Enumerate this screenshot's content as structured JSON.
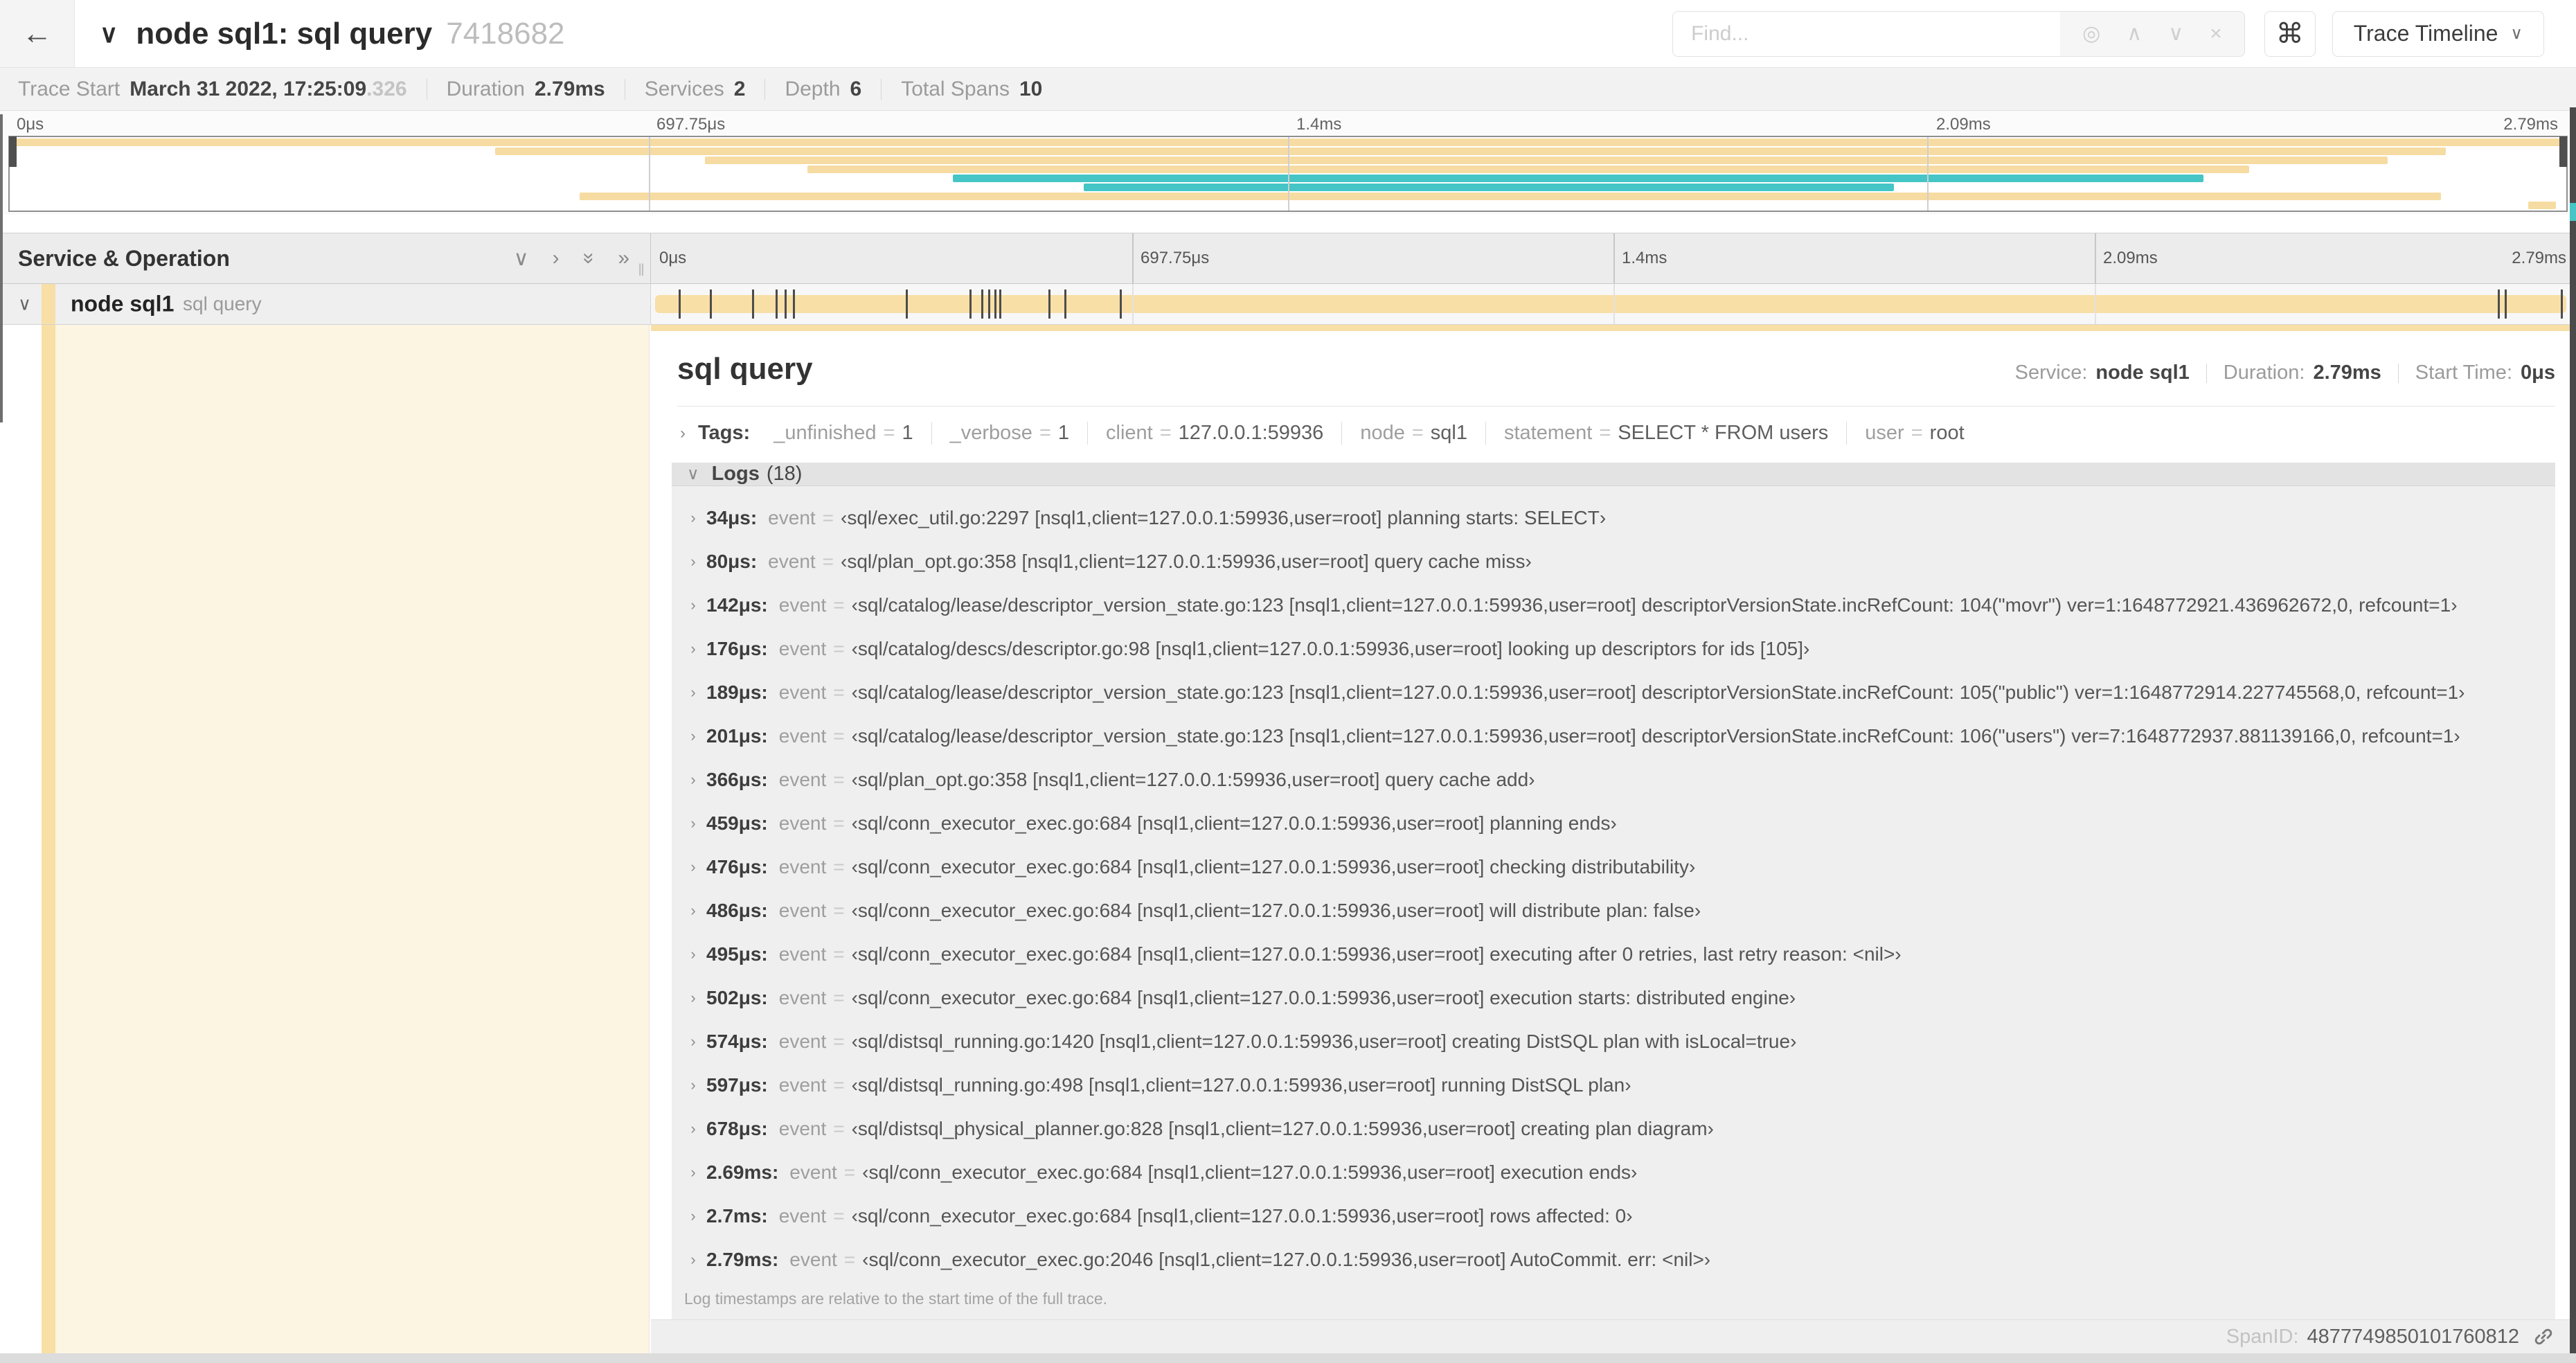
{
  "symbols": {
    "eq": "=",
    "chev_right": "›",
    "chev_down": "∨",
    "resizer": "‖"
  },
  "header": {
    "back": "←",
    "collapse": "∨",
    "title": "node sql1: sql query",
    "trace_id": "7418682",
    "find": {
      "placeholder": "Find...",
      "locate": "◎",
      "prev": "∧",
      "next": "∨",
      "clear": "×"
    },
    "shortcut": "⌘",
    "view_button": "Trace Timeline",
    "view_chevron": "∨"
  },
  "summary": {
    "items": [
      {
        "label": "Trace Start",
        "value": "March 31 2022, 17:25:09",
        "suffix": ".326"
      },
      {
        "label": "Duration",
        "value": "2.79ms",
        "suffix": ""
      },
      {
        "label": "Services",
        "value": "2",
        "suffix": ""
      },
      {
        "label": "Depth",
        "value": "6",
        "suffix": ""
      },
      {
        "label": "Total Spans",
        "value": "10",
        "suffix": ""
      }
    ]
  },
  "axis": [
    {
      "label": "0μs",
      "pct": 0
    },
    {
      "label": "697.75μs",
      "pct": 25
    },
    {
      "label": "1.4ms",
      "pct": 50
    },
    {
      "label": "2.09ms",
      "pct": 75
    },
    {
      "label": "2.79ms",
      "pct": 100
    }
  ],
  "minimap": {
    "colors": {
      "tan": "#f6dca2",
      "teal": "#45c5c5"
    },
    "spans": [
      {
        "row": 0,
        "start": 0,
        "end": 100,
        "color": "tan"
      },
      {
        "row": 1,
        "start": 19,
        "end": 95.3,
        "color": "tan"
      },
      {
        "row": 2,
        "start": 27.2,
        "end": 93,
        "color": "tan"
      },
      {
        "row": 3,
        "start": 31.2,
        "end": 87.6,
        "color": "tan"
      },
      {
        "row": 4,
        "start": 36.9,
        "end": 85.8,
        "color": "teal"
      },
      {
        "row": 5,
        "start": 42,
        "end": 73.7,
        "color": "teal"
      },
      {
        "row": 6,
        "start": 22.3,
        "end": 95.1,
        "color": "tan"
      },
      {
        "row": 7,
        "start": 98.5,
        "end": 99.6,
        "color": "tan"
      }
    ]
  },
  "timeline_head": {
    "title": "Service & Operation",
    "icons": [
      "∨",
      "›",
      "»",
      "»"
    ]
  },
  "span_row": {
    "collapse": "∨",
    "service": "node sql1",
    "operation": "sql query",
    "tick_pcts": [
      1.22,
      2.87,
      5.09,
      6.31,
      6.77,
      7.2,
      13.12,
      16.45,
      17.06,
      17.42,
      17.74,
      17.99,
      20.57,
      21.4,
      24.3,
      96.42,
      96.77,
      99.7
    ]
  },
  "detail": {
    "title": "sql query",
    "meta": [
      {
        "label": "Service:",
        "value": "node sql1"
      },
      {
        "label": "Duration:",
        "value": "2.79ms"
      },
      {
        "label": "Start Time:",
        "value": "0μs"
      }
    ],
    "tags": {
      "label": "Tags:",
      "items": [
        {
          "key": "_unfinished",
          "value": "1"
        },
        {
          "key": "_verbose",
          "value": "1"
        },
        {
          "key": "client",
          "value": "127.0.0.1:59936"
        },
        {
          "key": "node",
          "value": "sql1"
        },
        {
          "key": "statement",
          "value": "SELECT * FROM users"
        },
        {
          "key": "user",
          "value": "root"
        }
      ]
    },
    "logs": {
      "label": "Logs",
      "count": "(18)",
      "key_label": "event",
      "rows": [
        {
          "t": "34μs:",
          "value": "‹sql/exec_util.go:2297 [nsql1,client=127.0.0.1:59936,user=root] planning starts: SELECT›"
        },
        {
          "t": "80μs:",
          "value": "‹sql/plan_opt.go:358 [nsql1,client=127.0.0.1:59936,user=root] query cache miss›"
        },
        {
          "t": "142μs:",
          "value": "‹sql/catalog/lease/descriptor_version_state.go:123 [nsql1,client=127.0.0.1:59936,user=root] descriptorVersionState.incRefCount: 104(\"movr\") ver=1:1648772921.436962672,0, refcount=1›"
        },
        {
          "t": "176μs:",
          "value": "‹sql/catalog/descs/descriptor.go:98 [nsql1,client=127.0.0.1:59936,user=root] looking up descriptors for ids [105]›"
        },
        {
          "t": "189μs:",
          "value": "‹sql/catalog/lease/descriptor_version_state.go:123 [nsql1,client=127.0.0.1:59936,user=root] descriptorVersionState.incRefCount: 105(\"public\") ver=1:1648772914.227745568,0, refcount=1›"
        },
        {
          "t": "201μs:",
          "value": "‹sql/catalog/lease/descriptor_version_state.go:123 [nsql1,client=127.0.0.1:59936,user=root] descriptorVersionState.incRefCount: 106(\"users\") ver=7:1648772937.881139166,0, refcount=1›"
        },
        {
          "t": "366μs:",
          "value": "‹sql/plan_opt.go:358 [nsql1,client=127.0.0.1:59936,user=root] query cache add›"
        },
        {
          "t": "459μs:",
          "value": "‹sql/conn_executor_exec.go:684 [nsql1,client=127.0.0.1:59936,user=root] planning ends›"
        },
        {
          "t": "476μs:",
          "value": "‹sql/conn_executor_exec.go:684 [nsql1,client=127.0.0.1:59936,user=root] checking distributability›"
        },
        {
          "t": "486μs:",
          "value": "‹sql/conn_executor_exec.go:684 [nsql1,client=127.0.0.1:59936,user=root] will distribute plan: false›"
        },
        {
          "t": "495μs:",
          "value": "‹sql/conn_executor_exec.go:684 [nsql1,client=127.0.0.1:59936,user=root] executing after 0 retries, last retry reason: <nil>›"
        },
        {
          "t": "502μs:",
          "value": "‹sql/conn_executor_exec.go:684 [nsql1,client=127.0.0.1:59936,user=root] execution starts: distributed engine›"
        },
        {
          "t": "574μs:",
          "value": "‹sql/distsql_running.go:1420 [nsql1,client=127.0.0.1:59936,user=root] creating DistSQL plan with isLocal=true›"
        },
        {
          "t": "597μs:",
          "value": "‹sql/distsql_running.go:498 [nsql1,client=127.0.0.1:59936,user=root] running DistSQL plan›"
        },
        {
          "t": "678μs:",
          "value": "‹sql/distsql_physical_planner.go:828 [nsql1,client=127.0.0.1:59936,user=root] creating plan diagram›"
        },
        {
          "t": "2.69ms:",
          "value": "‹sql/conn_executor_exec.go:684 [nsql1,client=127.0.0.1:59936,user=root] execution ends›"
        },
        {
          "t": "2.7ms:",
          "value": "‹sql/conn_executor_exec.go:684 [nsql1,client=127.0.0.1:59936,user=root] rows affected: 0›"
        },
        {
          "t": "2.79ms:",
          "value": "‹sql/conn_executor_exec.go:2046 [nsql1,client=127.0.0.1:59936,user=root] AutoCommit. err: <nil>›"
        }
      ],
      "footer": "Log timestamps are relative to the start time of the full trace."
    },
    "span_id_label": "SpanID:",
    "span_id": "4877749850101760812"
  }
}
